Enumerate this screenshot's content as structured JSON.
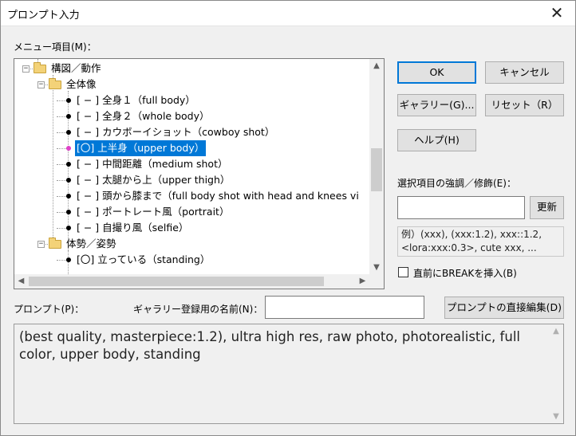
{
  "window": {
    "title": "プロンプト入力",
    "close_glyph": "✕"
  },
  "menu_label": "メニュー項目(M)：",
  "tree": {
    "rows": [
      {
        "text": "構図／動作",
        "kind": "folder",
        "expanded": true,
        "level": 1
      },
      {
        "text": "全体像",
        "kind": "folder",
        "expanded": true,
        "level": 2
      },
      {
        "text": "[ − ] 全身１（full body）",
        "kind": "item",
        "level": 3
      },
      {
        "text": "[ − ] 全身２（whole body）",
        "kind": "item",
        "level": 3
      },
      {
        "text": "[ − ] カウボーイショット（cowboy shot）",
        "kind": "item",
        "level": 3
      },
      {
        "text": "[〇] 上半身（upper body）",
        "kind": "item",
        "level": 3,
        "selected": true
      },
      {
        "text": "[ − ] 中間距離（medium shot）",
        "kind": "item",
        "level": 3
      },
      {
        "text": "[ − ] 太腿から上（upper thigh）",
        "kind": "item",
        "level": 3
      },
      {
        "text": "[ − ] 頭から膝まで（full body shot with head and knees vi",
        "kind": "item",
        "level": 3
      },
      {
        "text": "[ − ] ポートレート風（portrait）",
        "kind": "item",
        "level": 3
      },
      {
        "text": "[ − ] 自撮り風（selfie）",
        "kind": "item",
        "level": 3
      },
      {
        "text": "体勢／姿勢",
        "kind": "folder",
        "expanded": true,
        "level": 2
      },
      {
        "text": "[〇] 立っている（standing）",
        "kind": "item",
        "level": 3
      }
    ],
    "vscroll_position": 0.52,
    "hscroll_position": 0.0
  },
  "buttons": {
    "ok": "OK",
    "cancel": "キャンセル",
    "gallery": "ギャラリー(G)...",
    "reset": "リセット（R）",
    "help": "ヘルプ(H)",
    "update": "更新",
    "direct_edit": "プロンプトの直接編集(D)"
  },
  "emphasis": {
    "label": "選択項目の強調／修飾(E)：",
    "value": "",
    "example": "例）(xxx), (xxx:1.2), xxx::1.2, <lora:xxx:0.3>, cute xxx, ..."
  },
  "break": {
    "label": "直前にBREAKを挿入(B)",
    "checked": false
  },
  "prompt_label": "プロンプト(P)：",
  "gallery_name": {
    "label": "ギャラリー登録用の名前(N)：",
    "value": ""
  },
  "prompt_text": "(best quality, masterpiece:1.2), ultra high res, raw photo, photorealistic, full color, upper body, standing",
  "colors": {
    "selection": "#0078d7",
    "selected_bullet": "#e040c8",
    "default_button_border": "#0078d7"
  },
  "icons": {
    "folder": "folder-icon",
    "bullet": "bullet-icon",
    "up": "▲",
    "down": "▼",
    "left": "◀",
    "right": "▶"
  }
}
